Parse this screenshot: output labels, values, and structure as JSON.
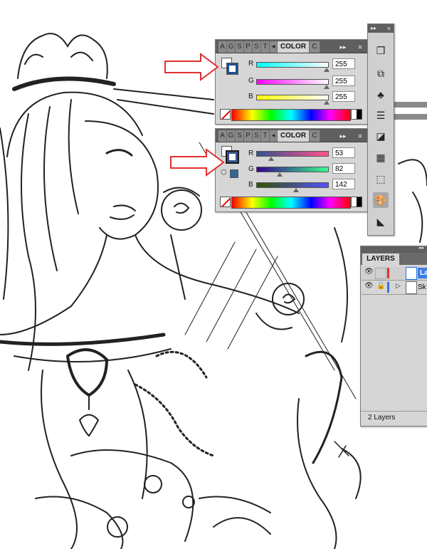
{
  "color_panel_top": {
    "tabs": [
      "A",
      "G",
      "S",
      "P",
      "S",
      "T"
    ],
    "active_tab_label": "COLOR",
    "next_tab_label": "C",
    "collapse_label": "▸▸",
    "menu_label": "≡",
    "channels": [
      {
        "label": "R",
        "value": "255"
      },
      {
        "label": "G",
        "value": "255"
      },
      {
        "label": "B",
        "value": "255"
      }
    ],
    "fill_color": "#ffffff",
    "stroke_color": "#1f4f8e"
  },
  "color_panel_bottom": {
    "tabs": [
      "A",
      "G",
      "S",
      "P",
      "S",
      "T"
    ],
    "active_tab_label": "COLOR",
    "next_tab_label": "C",
    "collapse_label": "▸▸",
    "menu_label": "≡",
    "channels": [
      {
        "label": "R",
        "value": "53"
      },
      {
        "label": "G",
        "value": "82"
      },
      {
        "label": "B",
        "value": "142"
      }
    ],
    "fill_color": "#ffffff",
    "stroke_color": "#35528e"
  },
  "tool_dock": {
    "collapse_label": "▸▸",
    "close_label": "×",
    "icons": [
      "new-document-icon",
      "layers-stack-icon",
      "club-symbol-icon",
      "stroke-lines-icon",
      "pathfinder-icon",
      "swatches-grid-icon",
      "transform-box-icon",
      "color-palette-icon",
      "gradient-icon"
    ]
  },
  "layers_panel": {
    "title": "LAYERS",
    "collapse_label": "◂◂",
    "layers": [
      {
        "name": "La",
        "color": "#e53030"
      },
      {
        "name": "Sk",
        "color": "#3a6fe0"
      }
    ],
    "status": "2 Layers"
  },
  "accents": {
    "callout_arrow": "#e03030",
    "panel_bg": "#d6d6d6",
    "tab_bg": "#5f5f5f"
  }
}
